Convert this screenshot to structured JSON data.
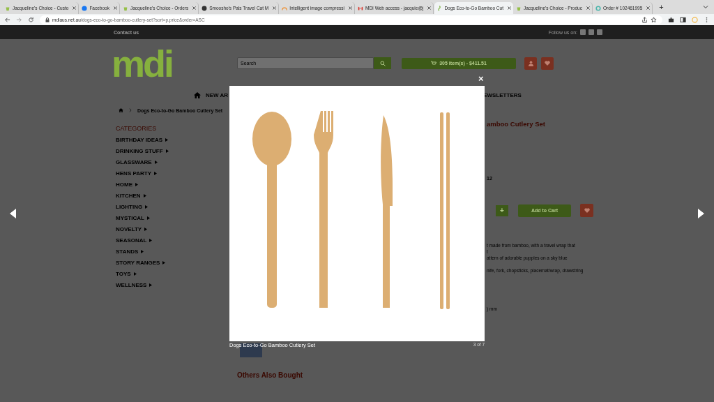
{
  "browser": {
    "tabs": [
      {
        "title": "Jacqueline's Choice - Custo",
        "kind": "shop",
        "selected": false
      },
      {
        "title": "Facebook",
        "kind": "facebook",
        "selected": false
      },
      {
        "title": "Jacqueline's Choice - Orders",
        "kind": "shop",
        "selected": false
      },
      {
        "title": "Smoosho's Pals Travel Cat M",
        "kind": "globe",
        "selected": false
      },
      {
        "title": "Intelligent image compressi",
        "kind": "arc",
        "selected": false
      },
      {
        "title": "MDI Web access - jacquie@j",
        "kind": "mail",
        "selected": false
      },
      {
        "title": "Dogs Eco-to-Go Bamboo Cut",
        "kind": "leaf",
        "selected": true
      },
      {
        "title": "Jacqueline's Choice - Produc",
        "kind": "shop",
        "selected": false
      },
      {
        "title": "Order # 102461995",
        "kind": "ring",
        "selected": false
      }
    ],
    "new_tab": "+",
    "url_host": "mdiaus.net.au",
    "url_path": "/dogs-eco-to-go-bamboo-cutlery-set?sort=p.price&order=ASC"
  },
  "top_bar": {
    "link": "Contact us",
    "follow_label": "Follow us on:"
  },
  "header": {
    "logo": "mdi",
    "search": {
      "placeholder": "Search"
    },
    "cart": "305 item(s) - $411.51"
  },
  "nav": {
    "items": [
      "NEW AR",
      "EWSLETTERS"
    ]
  },
  "breadcrumb": "Dogs Eco-to-Go Bamboo Cutlery Set",
  "categories": {
    "title": "CATEGORIES",
    "items": [
      "BIRTHDAY IDEAS",
      "DRINKING STUFF",
      "GLASSWARE",
      "HENS PARTY",
      "HOME",
      "KITCHEN",
      "LIGHTING",
      "MYSTICAL",
      "NOVELTY",
      "SEASONAL",
      "STANDS",
      "STORY RANGES",
      "TOYS",
      "WELLNESS"
    ]
  },
  "product": {
    "title": "amboo Cutlery Set",
    "price": "12",
    "plus": "+",
    "add_to_cart": "Add to Cart",
    "description": [
      "t made from bamboo, with a travel wrap that",
      "t",
      "attern of adorable puppies on a sky blue",
      "nife, fork, chopsticks, placemat/wrap, drawstring"
    ],
    "dimensions": ") mm"
  },
  "others": {
    "title": "Others Also Bought"
  },
  "lightbox": {
    "close": "×",
    "caption": "Dogs Eco-to-Go Bamboo Cutlery Set",
    "counter": "3 of 7"
  }
}
